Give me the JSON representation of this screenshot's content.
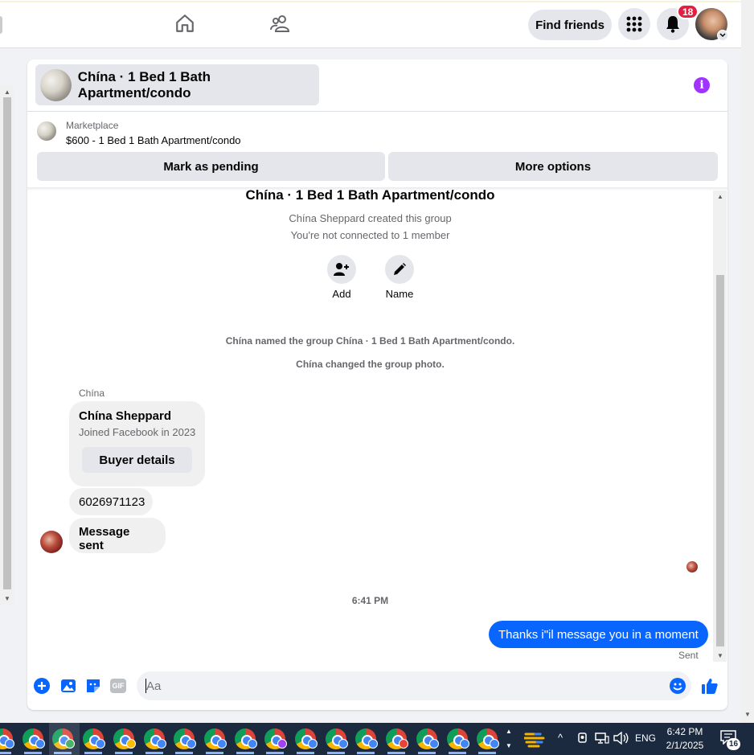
{
  "topbar": {
    "home_icon": "home-icon",
    "friends_icon": "friends-icon",
    "find_friends_label": "Find friends",
    "menu_icon": "grid-menu-icon",
    "notifications_icon": "bell-icon",
    "notification_count": "18",
    "avatar_icon": "profile-avatar"
  },
  "chat": {
    "title": "Chína · 1 Bed 1 Bath Apartment/condo",
    "info_icon": "info-icon",
    "marketplace_label": "Marketplace",
    "listing": "$600 - 1 Bed 1 Bath Apartment/condo",
    "mark_pending_label": "Mark as pending",
    "more_options_label": "More options"
  },
  "intro": {
    "group_title": "Chína · 1 Bed 1 Bath Apartment/condo",
    "created_text": "Chína Sheppard created this group",
    "not_connected_text": "You're not connected to 1 member",
    "add_label": "Add",
    "name_label": "Name"
  },
  "events": [
    "Chína named the group Chína · 1 Bed 1 Bath Apartment/condo.",
    "Chína changed the group photo."
  ],
  "messages": {
    "sender_name": "Chína",
    "card_name": "Chína Sheppard",
    "card_sub": "Joined Facebook in 2023",
    "buyer_details_label": "Buyer details",
    "phone": "6026971123",
    "message_sent": "Message sent",
    "timestamp": "6:41 PM",
    "outgoing": "Thanks i\"il message you in a moment",
    "sent_status": "Sent"
  },
  "composer": {
    "placeholder": "Aa"
  },
  "taskbar": {
    "language": "ENG",
    "time": "6:42 PM",
    "date": "2/1/2025",
    "notification_count": "16",
    "profile_colors": [
      "#4285f4",
      "#4285f4",
      "#34a853",
      "#4285f4",
      "#fbbc05",
      "#4285f4",
      "#4285f4",
      "#4285f4",
      "#4285f4",
      "#a142f4",
      "#4285f4",
      "#4285f4",
      "#4285f4",
      "#ea4335",
      "#4285f4",
      "#4285f4",
      "#4285f4"
    ]
  },
  "colors": {
    "accent": "#0866ff",
    "info": "#a033ff",
    "badge": "#e41e3f"
  }
}
